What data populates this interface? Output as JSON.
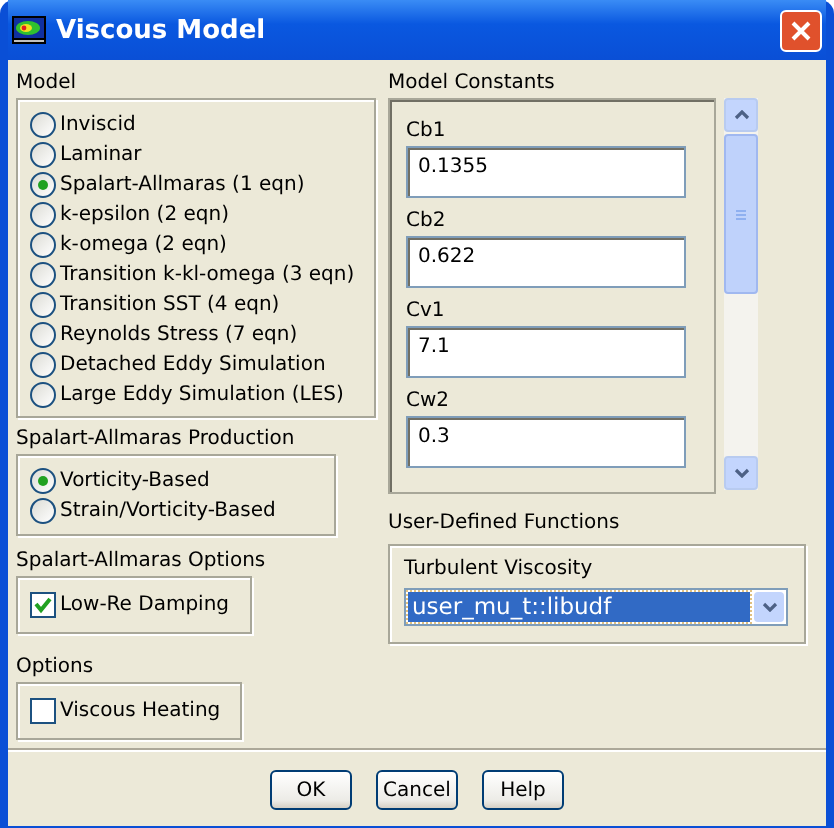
{
  "window": {
    "title": "Viscous Model"
  },
  "model": {
    "title": "Model",
    "options": [
      {
        "label": "Inviscid",
        "selected": false
      },
      {
        "label": "Laminar",
        "selected": false
      },
      {
        "label": "Spalart-Allmaras (1 eqn)",
        "selected": true
      },
      {
        "label": "k-epsilon (2 eqn)",
        "selected": false
      },
      {
        "label": "k-omega (2 eqn)",
        "selected": false
      },
      {
        "label": "Transition k-kl-omega (3 eqn)",
        "selected": false
      },
      {
        "label": "Transition SST (4 eqn)",
        "selected": false
      },
      {
        "label": "Reynolds Stress (7 eqn)",
        "selected": false
      },
      {
        "label": "Detached Eddy Simulation",
        "selected": false
      },
      {
        "label": "Large Eddy Simulation (LES)",
        "selected": false
      }
    ]
  },
  "production": {
    "title": "Spalart-Allmaras Production",
    "options": [
      {
        "label": "Vorticity-Based",
        "selected": true
      },
      {
        "label": "Strain/Vorticity-Based",
        "selected": false
      }
    ]
  },
  "sa_options": {
    "title": "Spalart-Allmaras Options",
    "items": [
      {
        "label": "Low-Re Damping",
        "checked": true
      }
    ]
  },
  "options": {
    "title": "Options",
    "items": [
      {
        "label": "Viscous Heating",
        "checked": false
      }
    ]
  },
  "model_constants": {
    "title": "Model Constants",
    "fields": [
      {
        "label": "Cb1",
        "value": "0.1355"
      },
      {
        "label": "Cb2",
        "value": "0.622"
      },
      {
        "label": "Cv1",
        "value": "7.1"
      },
      {
        "label": "Cw2",
        "value": "0.3"
      }
    ]
  },
  "udf": {
    "title": "User-Defined Functions",
    "fields": [
      {
        "label": "Turbulent Viscosity",
        "value": "user_mu_t::libudf"
      }
    ]
  },
  "buttons": [
    "OK",
    "Cancel",
    "Help"
  ]
}
